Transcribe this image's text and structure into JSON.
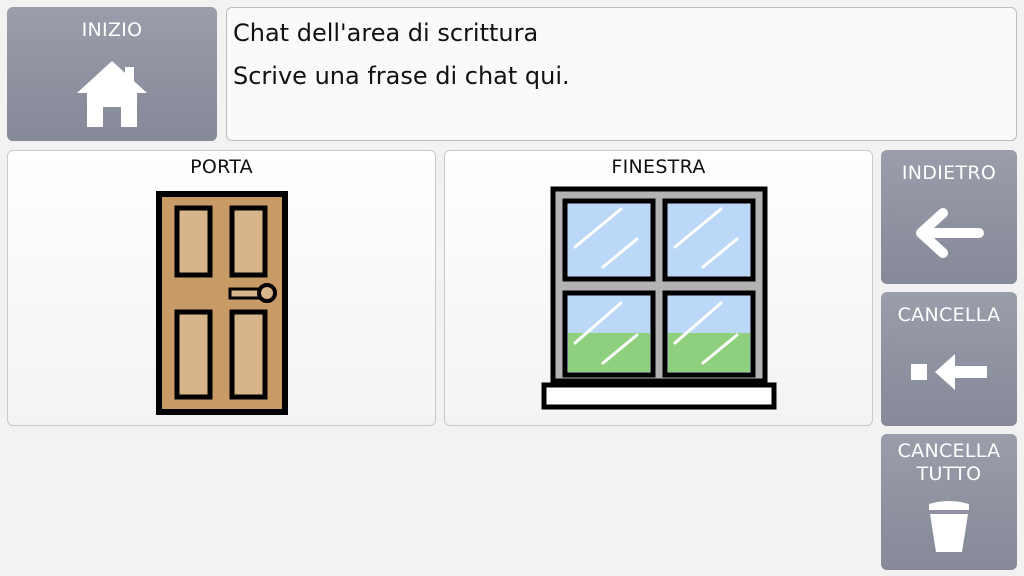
{
  "home": {
    "label": "INIZIO",
    "icon": "house-icon"
  },
  "chat": {
    "title": "Chat dell'area di scrittura",
    "text": "Scrive una frase di chat qui."
  },
  "cards": [
    {
      "label": "PORTA",
      "icon": "door-icon"
    },
    {
      "label": "FINESTRA",
      "icon": "window-icon"
    }
  ],
  "actions": {
    "back": {
      "label": "INDIETRO",
      "icon": "arrow-left-icon"
    },
    "delete": {
      "label": "CANCELLA",
      "icon": "backspace-icon"
    },
    "clear": {
      "label": "CANCELLA\nTUTTO",
      "icon": "trash-icon"
    }
  },
  "colors": {
    "side_button": "#8f93a0",
    "door": "#c89a66",
    "door_panel": "#d8b48a",
    "glass": "#bcd8f8",
    "grass": "#8fd07f"
  }
}
